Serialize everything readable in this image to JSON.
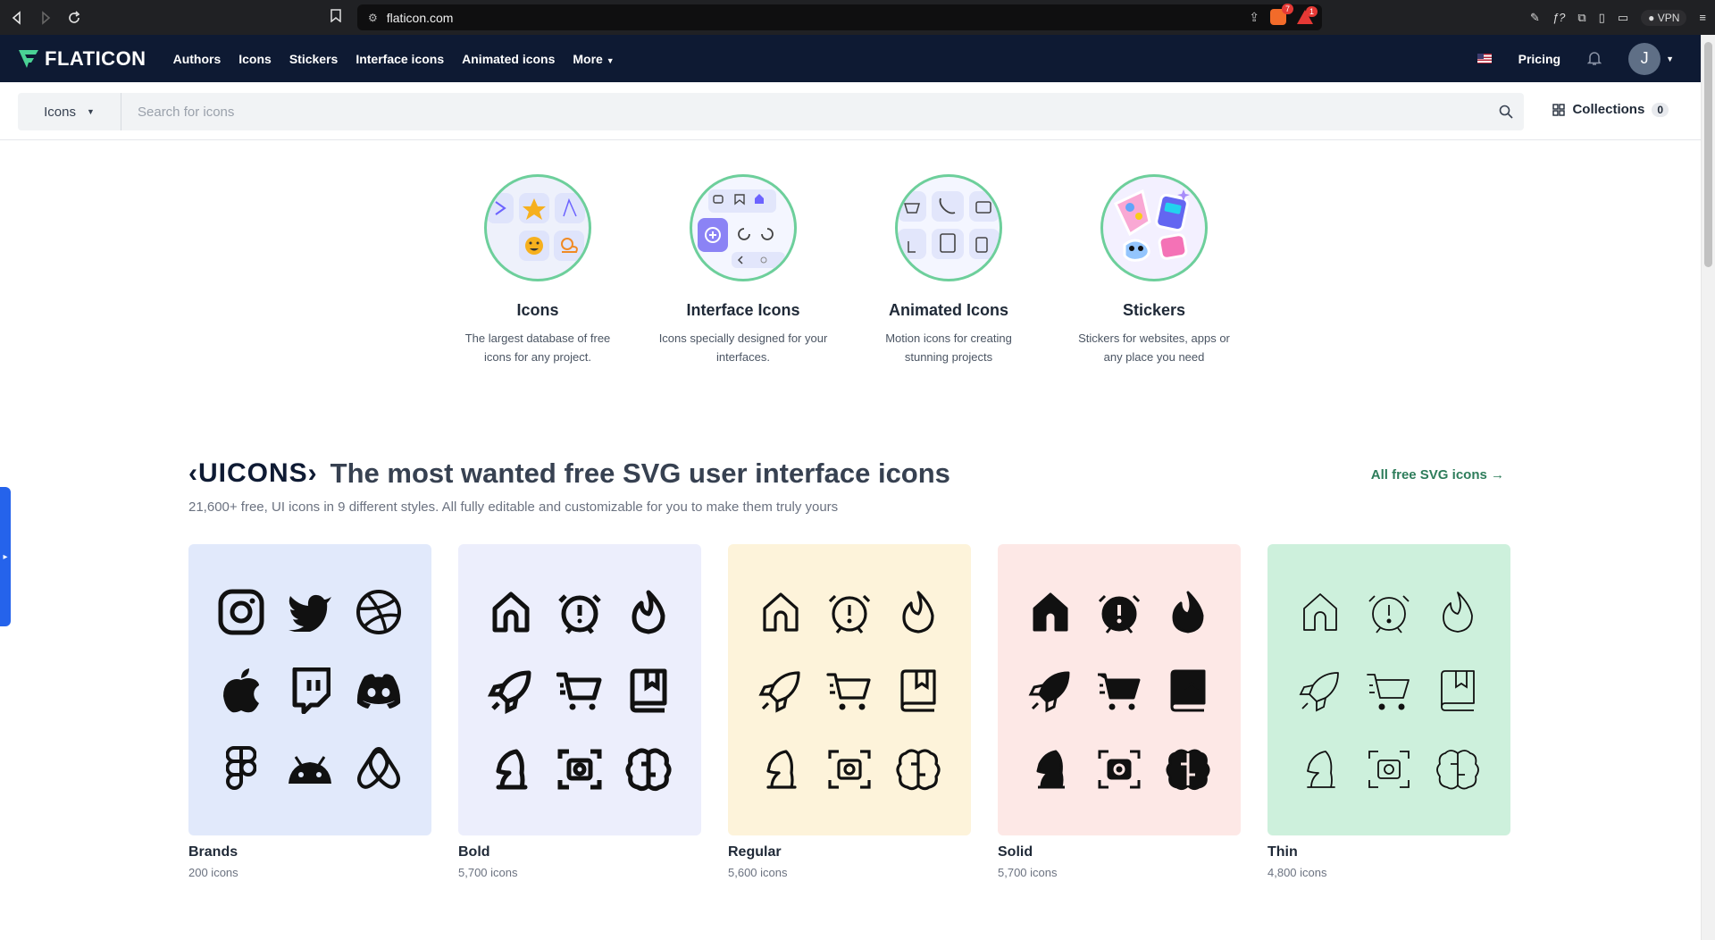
{
  "browser": {
    "url": "flaticon.com",
    "vpn_label": "VPN",
    "brave_badge": "7",
    "alert_badge": "1"
  },
  "header": {
    "logo_text": "FLATICON",
    "nav": [
      "Authors",
      "Icons",
      "Stickers",
      "Interface icons",
      "Animated icons",
      "More"
    ],
    "pricing": "Pricing",
    "avatar_initial": "J"
  },
  "search": {
    "type_label": "Icons",
    "placeholder": "Search for icons",
    "collections_label": "Collections",
    "collections_count": "0"
  },
  "categories": [
    {
      "title": "Icons",
      "desc": "The largest database of free icons for any project."
    },
    {
      "title": "Interface Icons",
      "desc": "Icons specially designed for your interfaces."
    },
    {
      "title": "Animated Icons",
      "desc": "Motion icons for creating stunning projects"
    },
    {
      "title": "Stickers",
      "desc": "Stickers for websites, apps or any place you need"
    }
  ],
  "uicons": {
    "logo": "‹UICONS›",
    "title": "The most wanted free SVG user interface icons",
    "subtitle": "21,600+ free, UI icons in 9 different styles. All fully editable and customizable for you to make them truly yours",
    "all_link": "All free SVG icons →"
  },
  "cards": [
    {
      "name": "Brands",
      "count": "200 icons",
      "bg": "#e1e9fb",
      "icons": [
        "instagram-icon",
        "twitter-icon",
        "dribbble-icon",
        "apple-icon",
        "twitch-icon",
        "discord-icon",
        "figma-icon",
        "android-icon",
        "airbnb-icon"
      ]
    },
    {
      "name": "Bold",
      "count": "5,700 icons",
      "bg": "#eceefc",
      "icons": [
        "home-icon",
        "alarm-icon",
        "flame-icon",
        "rocket-icon",
        "cart-icon",
        "bookmark-book-icon",
        "chess-knight-icon",
        "camera-icon",
        "brain-icon"
      ]
    },
    {
      "name": "Regular",
      "count": "5,600 icons",
      "bg": "#fdf3da",
      "icons": [
        "home-icon",
        "alarm-icon",
        "flame-icon",
        "rocket-icon",
        "cart-icon",
        "bookmark-book-icon",
        "chess-knight-icon",
        "camera-icon",
        "brain-icon"
      ]
    },
    {
      "name": "Solid",
      "count": "5,700 icons",
      "bg": "#fde8e6",
      "icons": [
        "home-icon",
        "alarm-icon",
        "flame-icon",
        "rocket-icon",
        "cart-icon",
        "bookmark-book-icon",
        "chess-knight-icon",
        "camera-icon",
        "brain-icon"
      ]
    },
    {
      "name": "Thin",
      "count": "4,800 icons",
      "bg": "#cdf0dc",
      "icons": [
        "home-icon",
        "alarm-icon",
        "flame-icon",
        "rocket-icon",
        "cart-icon",
        "bookmark-book-icon",
        "chess-knight-icon",
        "camera-icon",
        "brain-icon"
      ]
    }
  ],
  "colors": {
    "header_bg": "#0e1a33",
    "accent_green": "#2e7d5b",
    "circle_border": "#6dcf9b"
  }
}
